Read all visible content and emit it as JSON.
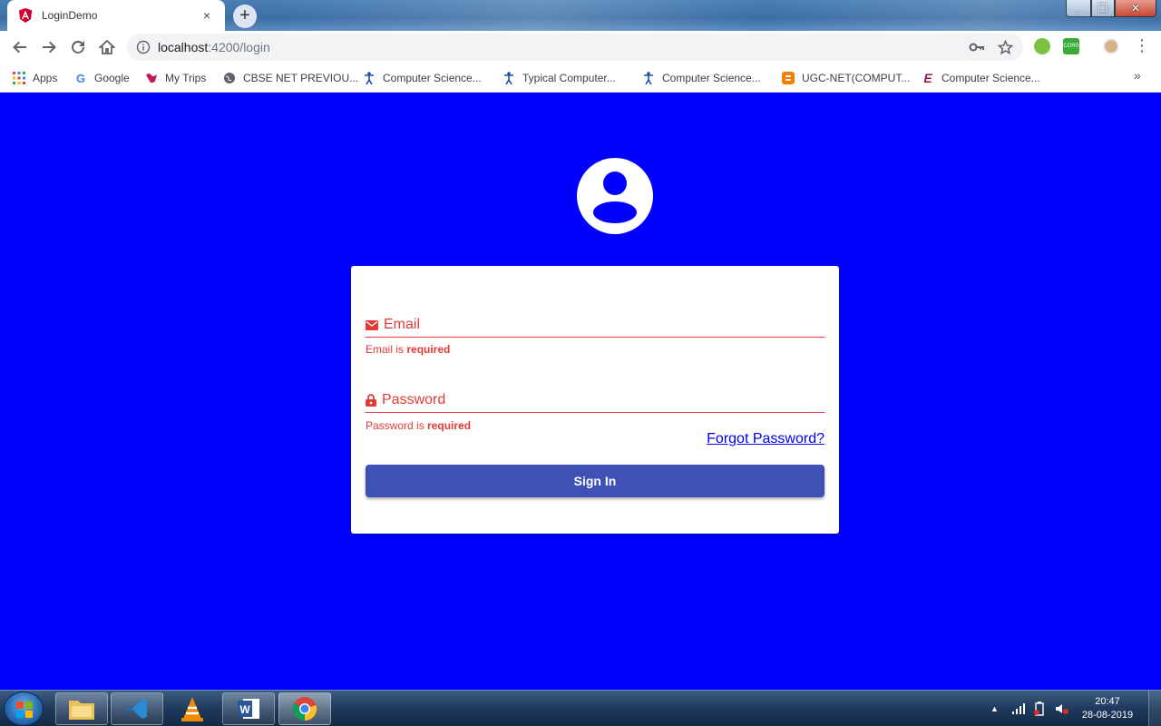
{
  "browser": {
    "tab_title": "LoginDemo",
    "tab_close": "×",
    "new_tab": "+",
    "url_host": "localhost",
    "url_path": ":4200/login"
  },
  "bookmarks": [
    {
      "label": "Apps",
      "icon": "apps-grid-icon"
    },
    {
      "label": "Google",
      "icon": "google-icon"
    },
    {
      "label": "My Trips",
      "icon": "trips-icon"
    },
    {
      "label": "CBSE NET PREVIOU...",
      "icon": "globe-icon"
    },
    {
      "label": "Computer Science...",
      "icon": "figure-icon"
    },
    {
      "label": "Typical Computer...",
      "icon": "figure-icon"
    },
    {
      "label": "Computer Science...",
      "icon": "figure-icon"
    },
    {
      "label": "UGC-NET(COMPUT...",
      "icon": "blogger-icon"
    },
    {
      "label": "Computer Science...",
      "icon": "e-logo-icon"
    }
  ],
  "bookmarks_more": "»",
  "login": {
    "email_label": "Email",
    "email_error_prefix": "Email is",
    "email_error_strong": "required",
    "password_label": "Password",
    "password_error_prefix": "Password is",
    "password_error_strong": "required",
    "forgot_link": "Forgot Password?",
    "signin_label": "Sign In"
  },
  "taskbar": {
    "time": "20:47",
    "date": "28-08-2019"
  },
  "colors": {
    "page_bg": "#0000ff",
    "error": "#e53935",
    "button": "#3f51b5",
    "link": "#0000ee"
  }
}
